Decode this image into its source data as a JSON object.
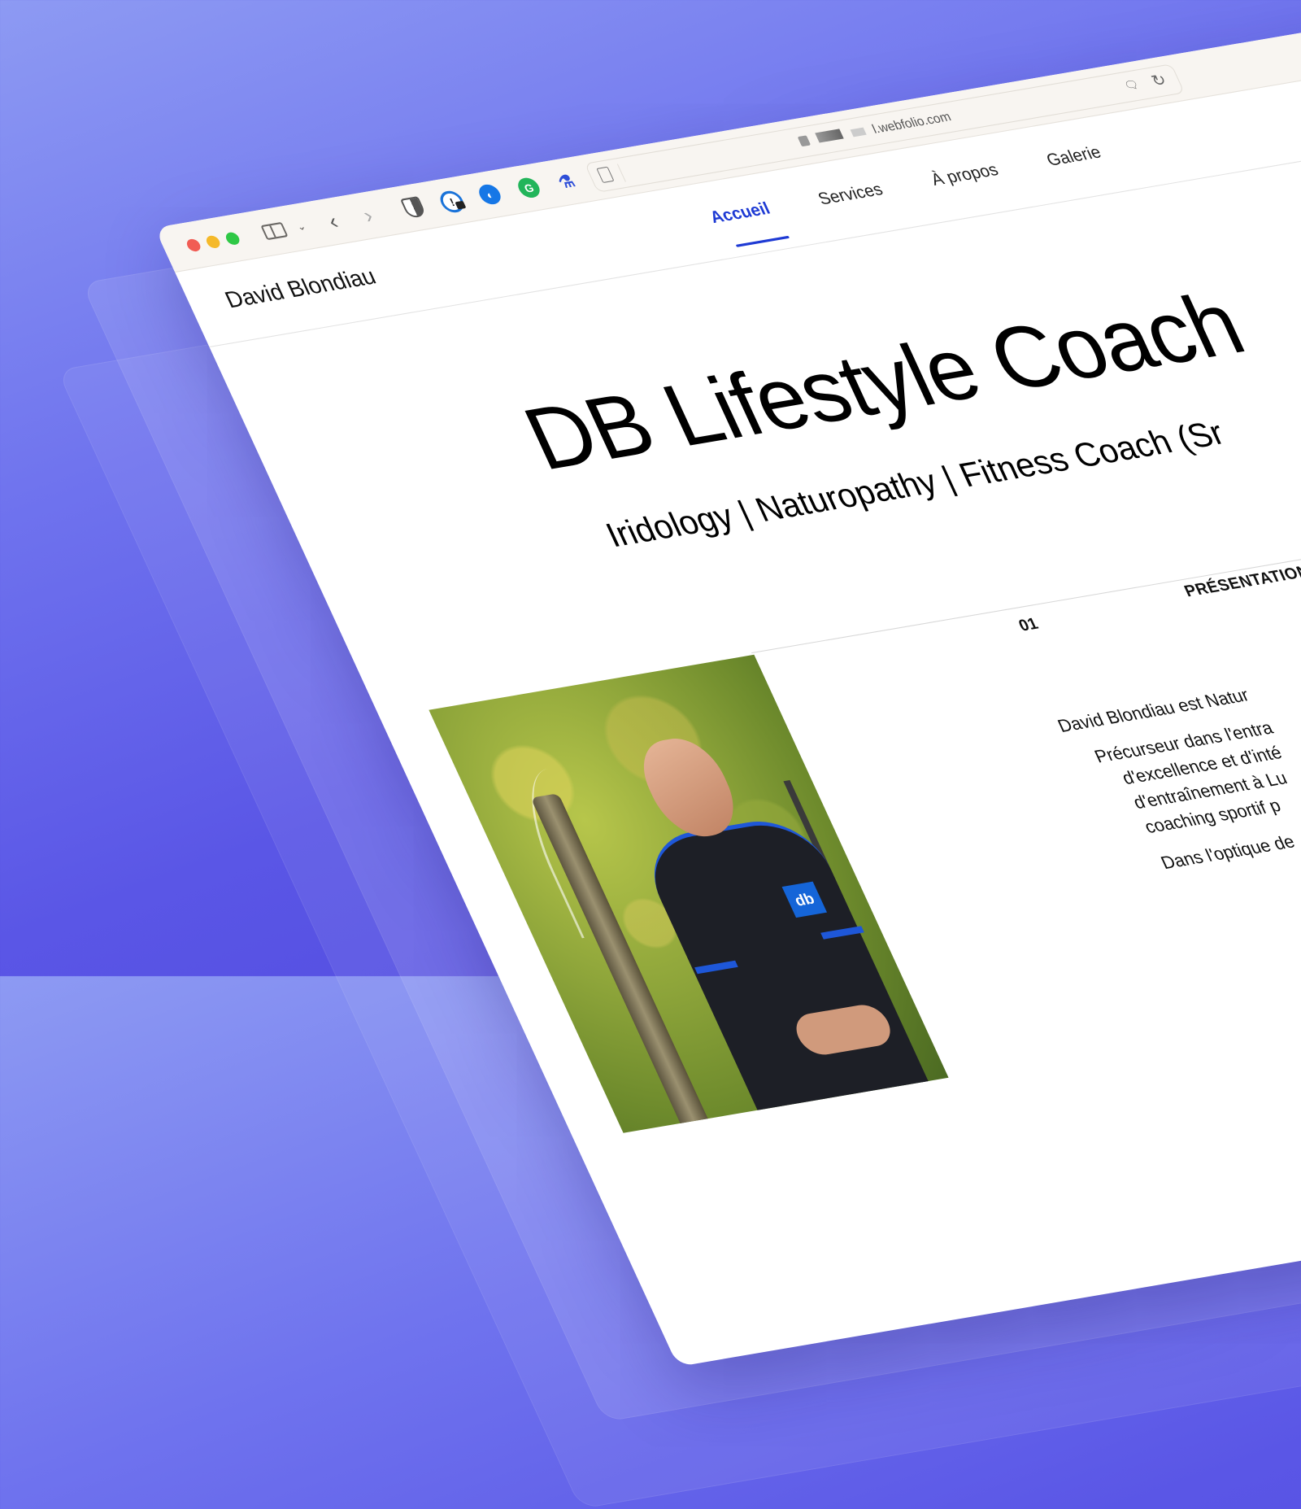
{
  "browser": {
    "url_suffix": "l.webfolio.com",
    "traffic_lights": [
      "close",
      "minimize",
      "zoom"
    ],
    "toolbar_icons": [
      "sidebar-icon",
      "chevron-down-icon",
      "back-icon",
      "forward-icon"
    ],
    "extensions": [
      "shield-extension",
      "1password-extension",
      "blue-extension",
      "grammarly-extension",
      "flask-extension"
    ],
    "url_icons": [
      "reader-icon",
      "lock-icon",
      "translate-icon",
      "reload-icon"
    ]
  },
  "site": {
    "name": "David Blondiau",
    "nav": [
      {
        "label": "Accueil",
        "active": true
      },
      {
        "label": "Services",
        "active": false
      },
      {
        "label": "À propos",
        "active": false
      },
      {
        "label": "Galerie",
        "active": false
      }
    ],
    "accent": "#1e3ad4"
  },
  "hero": {
    "title": "DB Lifestyle Coach",
    "subtitle": "Iridology | Naturopathy | Fitness Coach (Sr"
  },
  "section": {
    "number": "01",
    "label": "PRÉSENTATION",
    "paragraphs": [
      "David Blondiau est Natur",
      "Précurseur dans l'entra",
      "d'excellence et d'inté",
      "d'entraînement à Lu",
      "coaching sportif p",
      "Dans l'optique de"
    ]
  },
  "photo": {
    "alt": "David Blondiau portrait near a fountain",
    "shirt_logo": "db"
  }
}
